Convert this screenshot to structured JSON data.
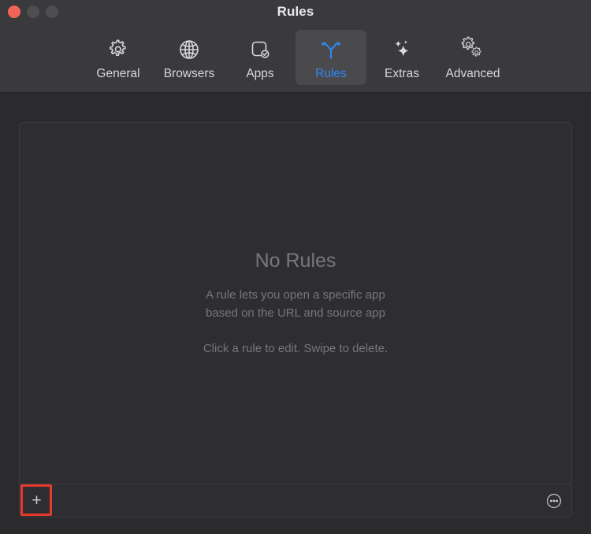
{
  "window": {
    "title": "Rules",
    "traffic_lights": [
      {
        "name": "close",
        "color": "#f2645a"
      },
      {
        "name": "minimize",
        "color": "#4e4e51"
      },
      {
        "name": "maximize",
        "color": "#4e4e51"
      }
    ]
  },
  "toolbar": {
    "selected": "Rules",
    "accent_color": "#2f88f7",
    "items": [
      {
        "label": "General",
        "icon": "gear-icon",
        "selected": false
      },
      {
        "label": "Browsers",
        "icon": "globe-icon",
        "selected": false
      },
      {
        "label": "Apps",
        "icon": "app-check-icon",
        "selected": false
      },
      {
        "label": "Rules",
        "icon": "branch-arrows-icon",
        "selected": true
      },
      {
        "label": "Extras",
        "icon": "sparkles-icon",
        "selected": false
      },
      {
        "label": "Advanced",
        "icon": "gears-icon",
        "selected": false
      }
    ]
  },
  "main": {
    "empty_state": {
      "title": "No Rules",
      "description_line1": "A rule lets you open a specific app",
      "description_line2": "based on the URL and source app",
      "hint": "Click a rule to edit. Swipe to delete."
    },
    "bottom_bar": {
      "add_label": "+",
      "add_icon": "plus-icon",
      "more_icon": "ellipsis-circle-icon"
    }
  },
  "annotation": {
    "color": "#e8392b",
    "target": "add-rule-button"
  }
}
